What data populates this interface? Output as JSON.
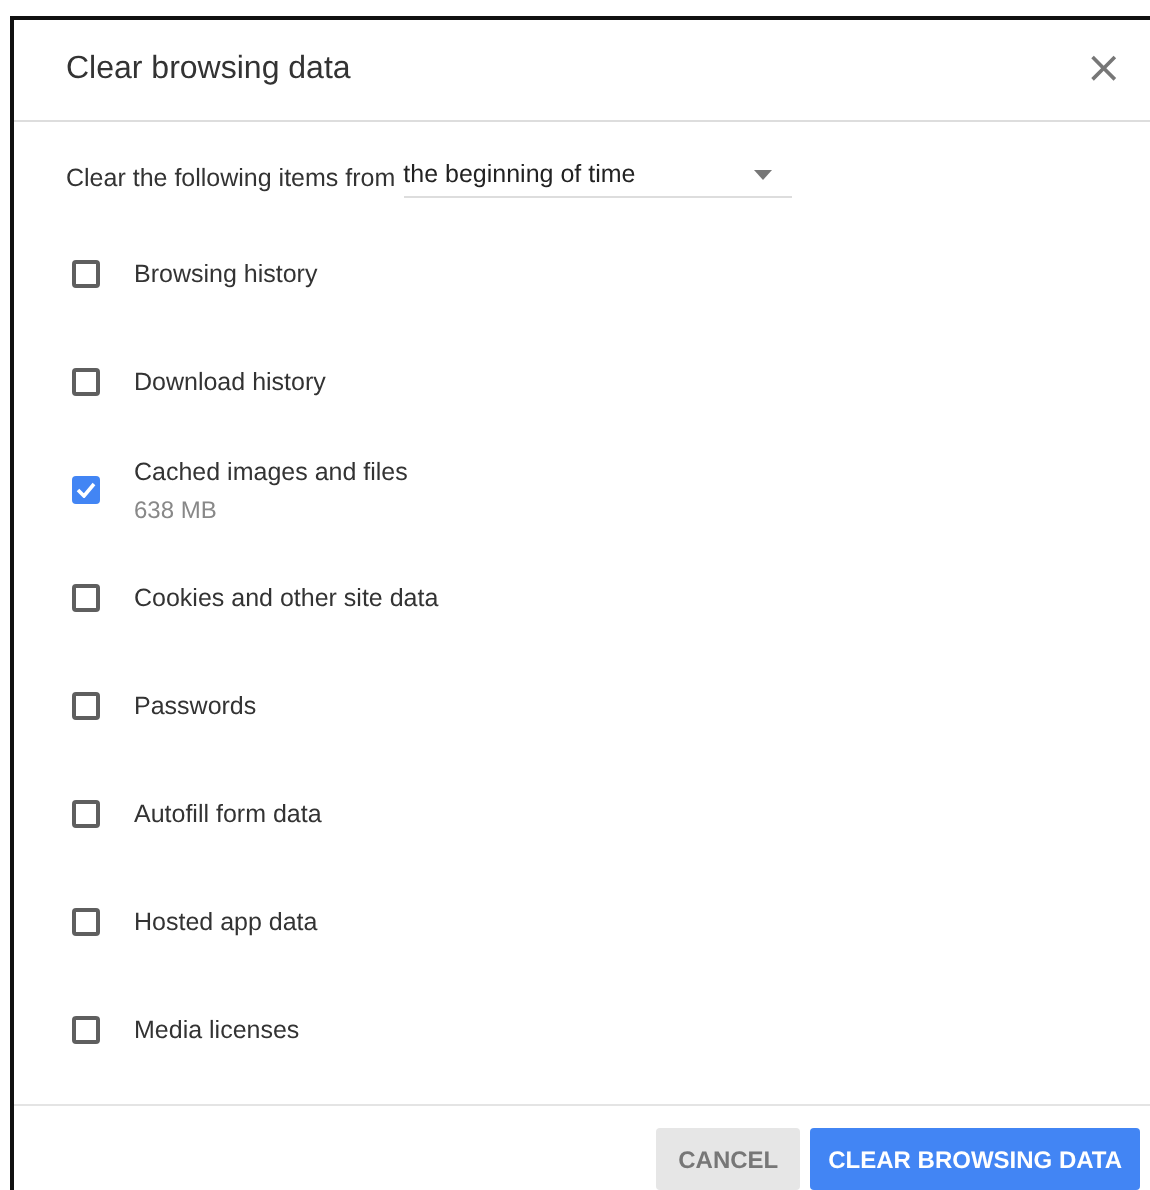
{
  "dialog": {
    "title": "Clear browsing data",
    "close_icon": "×"
  },
  "range": {
    "label": "Clear the following items from",
    "value": "the beginning of time"
  },
  "items": [
    {
      "label": "Browsing history",
      "checked": false
    },
    {
      "label": "Download history",
      "checked": false
    },
    {
      "label": "Cached images and files",
      "detail": "638 MB",
      "checked": true
    },
    {
      "label": "Cookies and other site data",
      "checked": false
    },
    {
      "label": "Passwords",
      "checked": false
    },
    {
      "label": "Autofill form data",
      "checked": false
    },
    {
      "label": "Hosted app data",
      "checked": false
    },
    {
      "label": "Media licenses",
      "checked": false
    }
  ],
  "buttons": [
    {
      "label": "CANCEL",
      "kind": "secondary"
    },
    {
      "label": "CLEAR BROWSING DATA",
      "kind": "primary"
    }
  ]
}
